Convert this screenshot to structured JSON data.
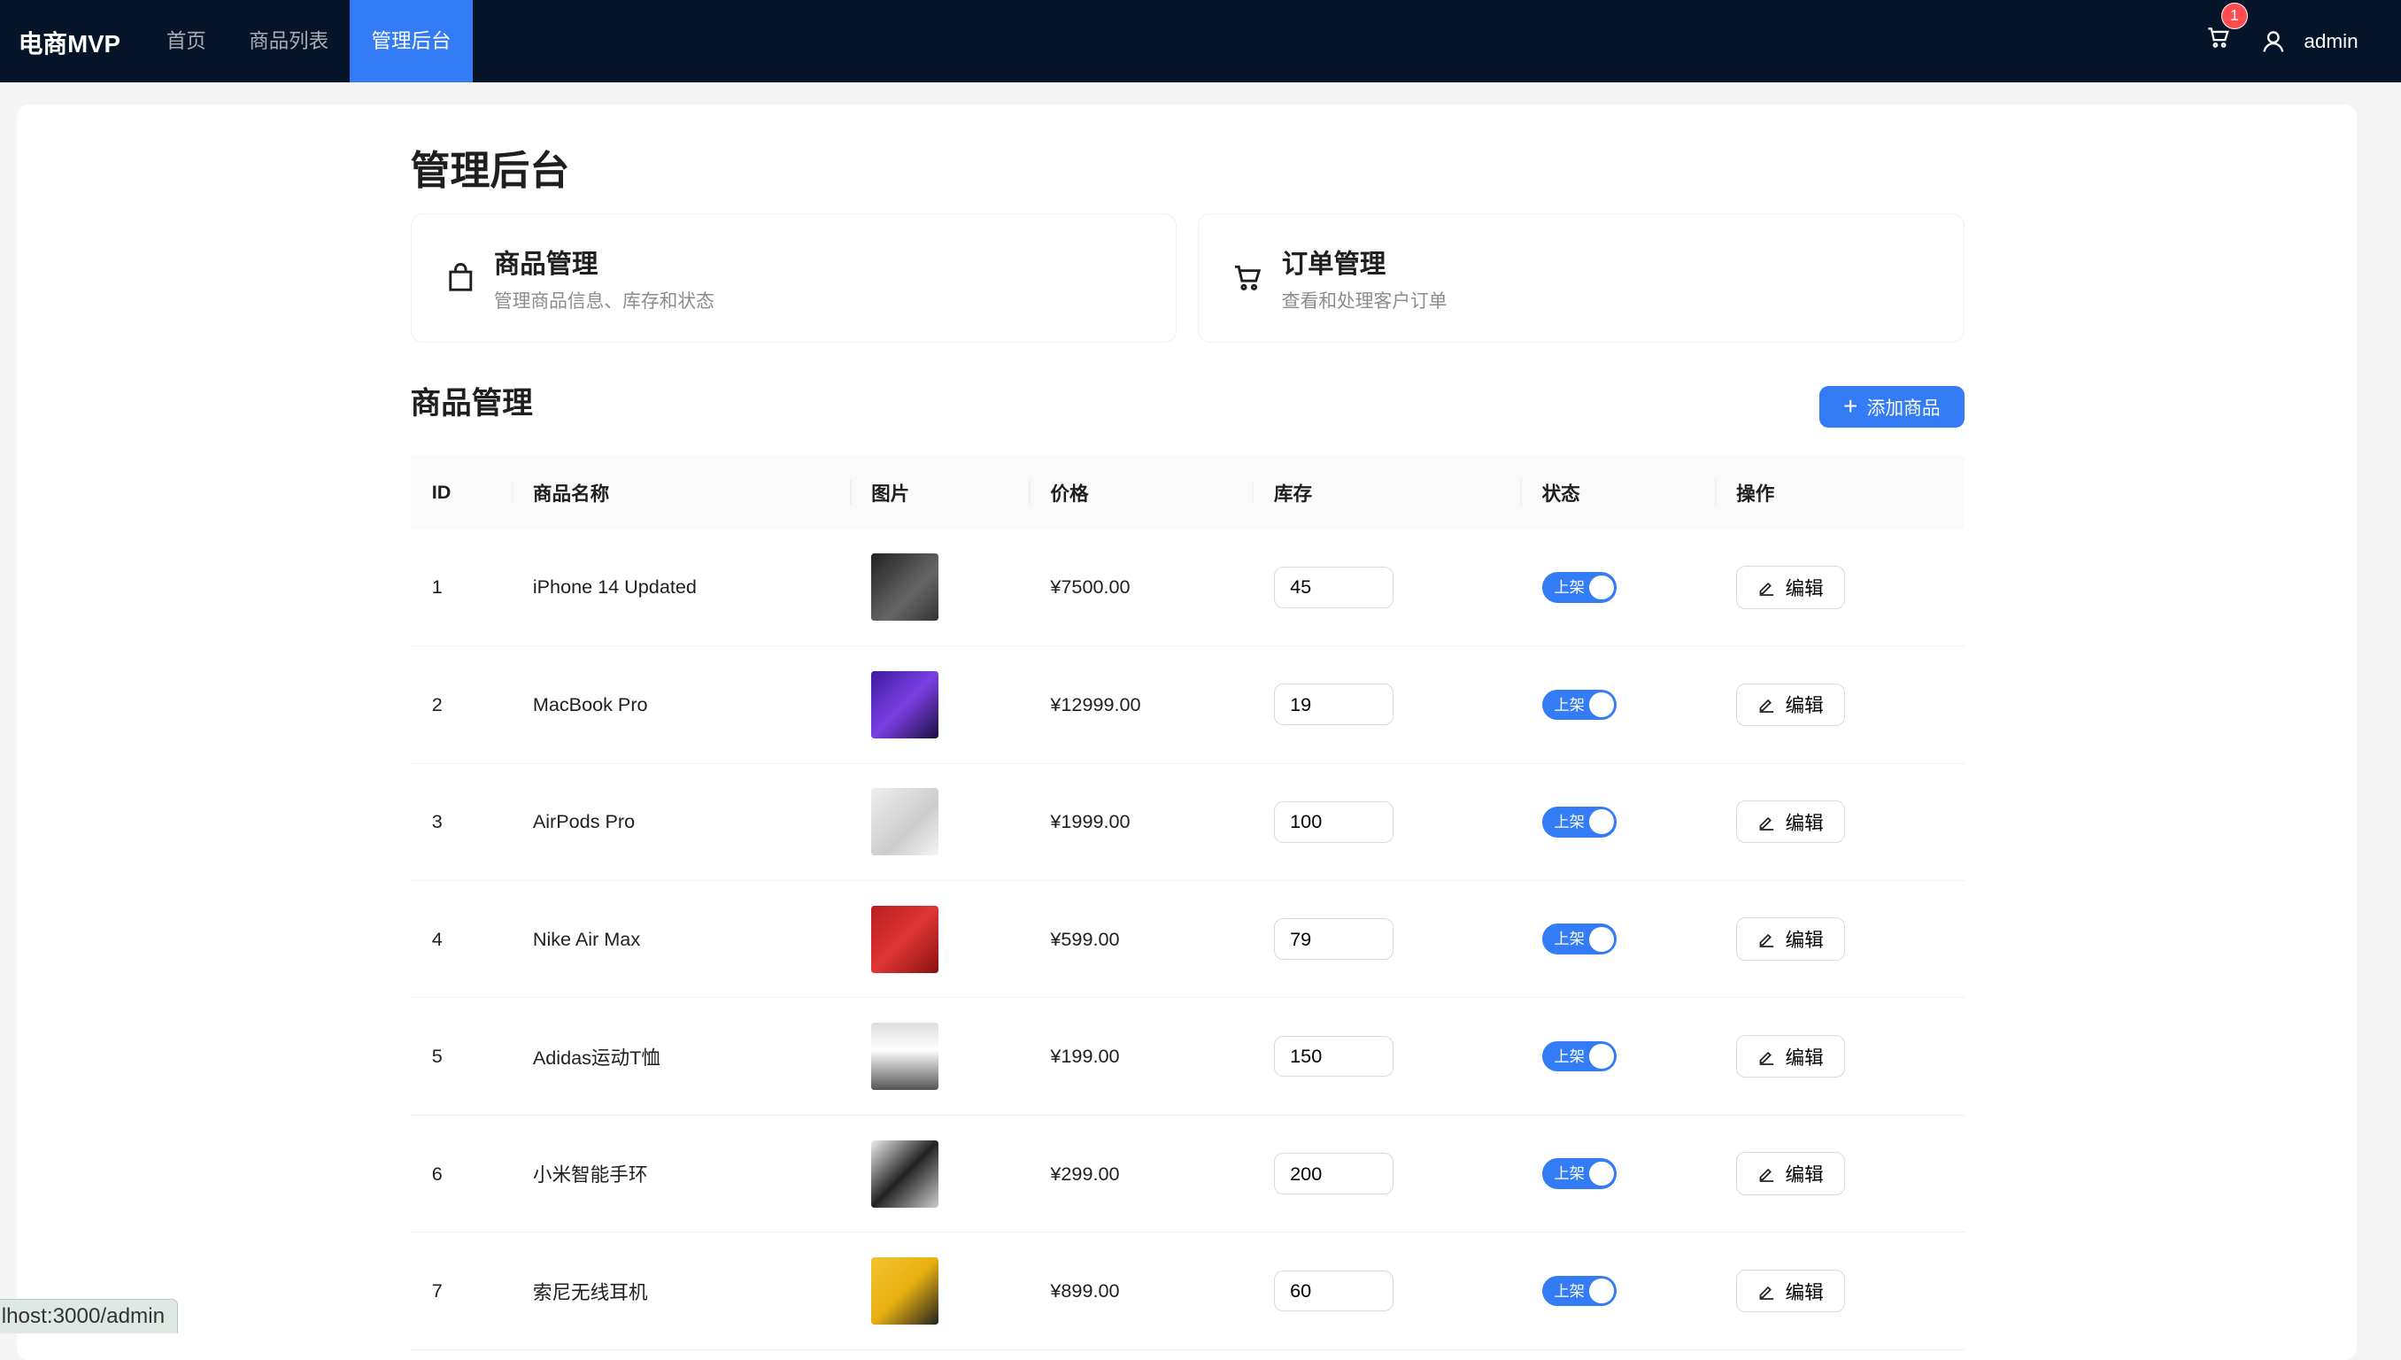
{
  "nav": {
    "logo": "电商MVP",
    "items": [
      "首页",
      "商品列表",
      "管理后台"
    ],
    "active": 2,
    "cart_count": "1",
    "user": "admin"
  },
  "page": {
    "title": "管理后台"
  },
  "cards": [
    {
      "title": "商品管理",
      "desc": "管理商品信息、库存和状态",
      "icon": "shopping-bag-icon"
    },
    {
      "title": "订单管理",
      "desc": "查看和处理客户订单",
      "icon": "cart-icon"
    }
  ],
  "section": {
    "title": "商品管理",
    "add_label": "添加商品"
  },
  "table": {
    "headers": [
      "ID",
      "商品名称",
      "图片",
      "价格",
      "库存",
      "状态",
      "操作"
    ],
    "rows": [
      {
        "id": "1",
        "name": "iPhone 14 Updated",
        "price": "¥7500.00",
        "stock": "45",
        "status": "上架",
        "action": "编辑"
      },
      {
        "id": "2",
        "name": "MacBook Pro",
        "price": "¥12999.00",
        "stock": "19",
        "status": "上架",
        "action": "编辑"
      },
      {
        "id": "3",
        "name": "AirPods Pro",
        "price": "¥1999.00",
        "stock": "100",
        "status": "上架",
        "action": "编辑"
      },
      {
        "id": "4",
        "name": "Nike Air Max",
        "price": "¥599.00",
        "stock": "79",
        "status": "上架",
        "action": "编辑"
      },
      {
        "id": "5",
        "name": "Adidas运动T恤",
        "price": "¥199.00",
        "stock": "150",
        "status": "上架",
        "action": "编辑"
      },
      {
        "id": "6",
        "name": "小米智能手环",
        "price": "¥299.00",
        "stock": "200",
        "status": "上架",
        "action": "编辑"
      },
      {
        "id": "7",
        "name": "索尼无线耳机",
        "price": "¥899.00",
        "stock": "60",
        "status": "上架",
        "action": "编辑"
      }
    ]
  },
  "statusbar": "lhost:3000/admin",
  "colors": {
    "nav_bg": "#051428",
    "primary": "#337cf6"
  }
}
